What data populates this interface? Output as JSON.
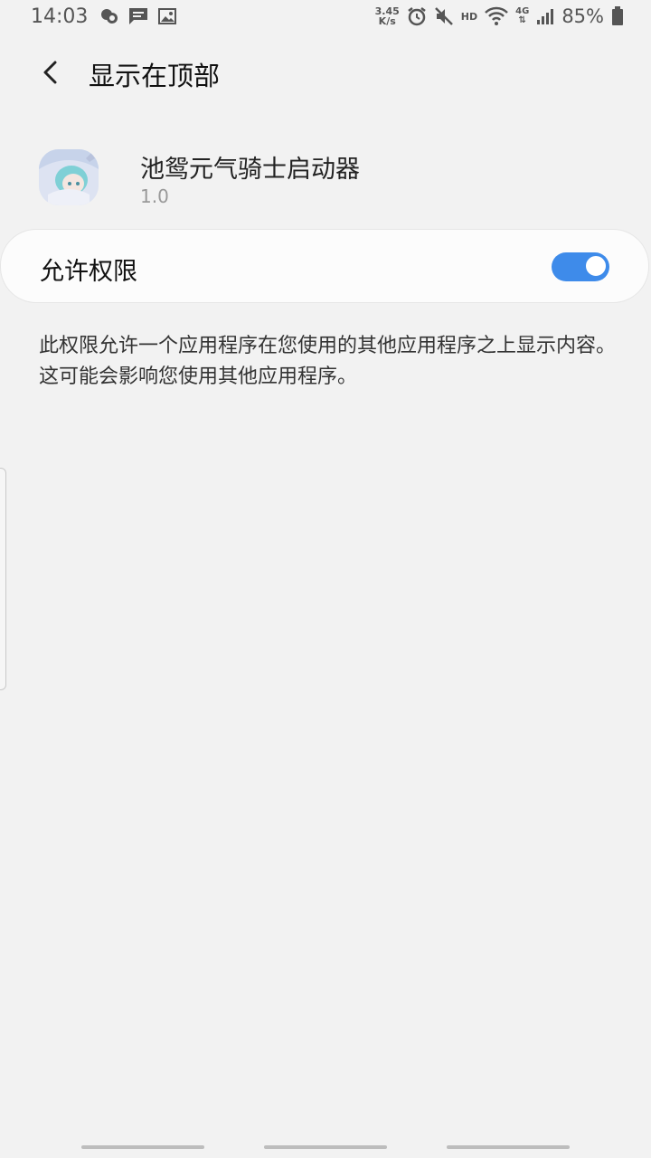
{
  "status_bar": {
    "time": "14:03",
    "net_speed_value": "3.45",
    "net_speed_unit": "K/s",
    "hd_label": "HD",
    "network_type": "4G",
    "battery_percent": "85%",
    "left_icons": [
      "weather-icon",
      "message-icon",
      "image-icon"
    ],
    "right_icons": [
      "alarm-icon",
      "mute-icon",
      "wifi-icon",
      "signal-icon",
      "battery-icon"
    ]
  },
  "app_bar": {
    "title": "显示在顶部"
  },
  "app": {
    "name": "池鸳元气骑士启动器",
    "version": "1.0"
  },
  "permission": {
    "label": "允许权限",
    "enabled": true
  },
  "description": "此权限允许一个应用程序在您使用的其他应用程序之上显示内容。这可能会影响您使用其他应用程序。",
  "colors": {
    "background": "#f2f2f2",
    "card": "#fcfcfc",
    "accent": "#3e8bea"
  }
}
